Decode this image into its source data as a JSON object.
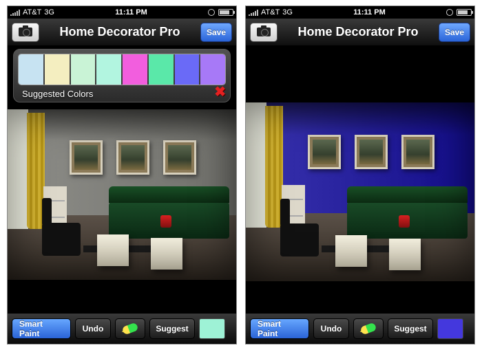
{
  "status": {
    "carrier": "AT&T",
    "network": "3G",
    "time": "11:11 PM"
  },
  "nav": {
    "title": "Home Decorator Pro",
    "save_label": "Save"
  },
  "palette": {
    "label": "Suggested Colors",
    "swatches": [
      "#c7e3f2",
      "#f4eec0",
      "#c9f3d6",
      "#b2f5e0",
      "#f25ede",
      "#5ae8a9",
      "#6a6af7",
      "#a779f7"
    ]
  },
  "toolbar": {
    "smart_paint": "Smart Paint",
    "undo": "Undo",
    "suggest": "Suggest"
  },
  "screens": [
    {
      "wall_color": "#8e8e89",
      "selected_color": "#9ef2d6"
    },
    {
      "wall_color": "#3a34b0",
      "selected_color": "#4438dd"
    }
  ]
}
